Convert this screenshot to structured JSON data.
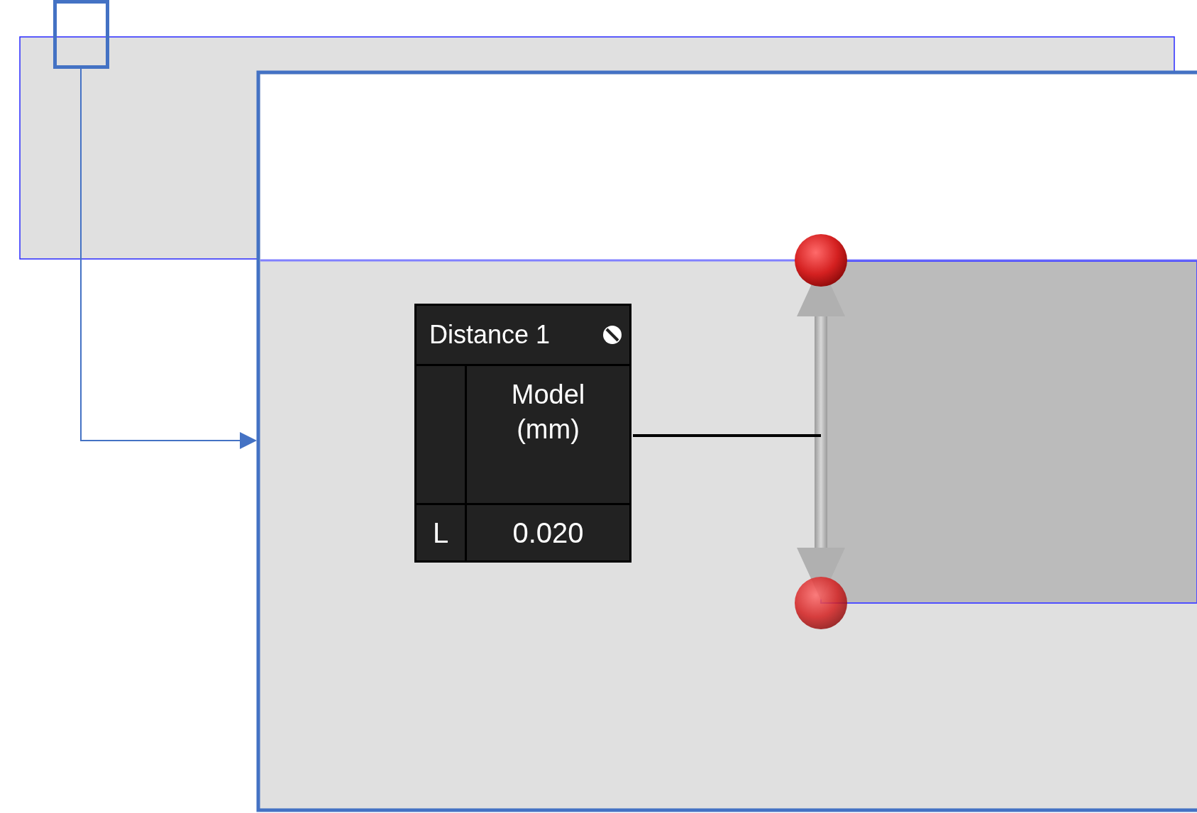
{
  "measurement_label": {
    "title": "Distance 1",
    "column_header": "Model (mm)",
    "rows": [
      {
        "label": "L",
        "value": "0.020"
      }
    ]
  }
}
